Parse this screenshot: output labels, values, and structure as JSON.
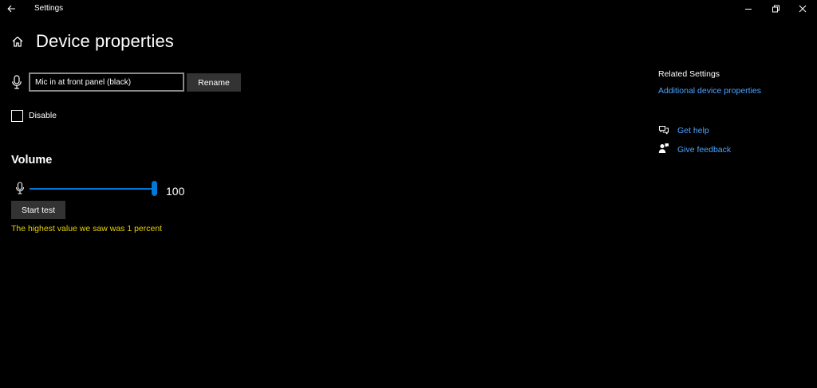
{
  "window": {
    "title": "Settings"
  },
  "header": {
    "title": "Device properties"
  },
  "device": {
    "name_value": "Mic in at front panel (black)",
    "rename_label": "Rename",
    "disable_label": "Disable",
    "disabled": false
  },
  "volume": {
    "heading": "Volume",
    "value": 100,
    "value_text": "100",
    "min": 0,
    "max": 100,
    "start_test_label": "Start test",
    "test_result": "The highest value we saw was 1 percent"
  },
  "related": {
    "heading": "Related Settings",
    "additional_link": "Additional device properties"
  },
  "support": {
    "help_label": "Get help",
    "feedback_label": "Give feedback"
  },
  "icons": {
    "back": "back-arrow-icon",
    "home": "home-icon",
    "microphone": "microphone-icon",
    "help": "chat-help-icon",
    "feedback": "feedback-icon",
    "minimize": "minimize-icon",
    "restore": "restore-icon",
    "close": "close-icon"
  },
  "colors": {
    "background": "#000000",
    "accent": "#0078d7",
    "link": "#4ca3ff",
    "warning_text": "#e8d100",
    "button_bg": "#333333"
  }
}
